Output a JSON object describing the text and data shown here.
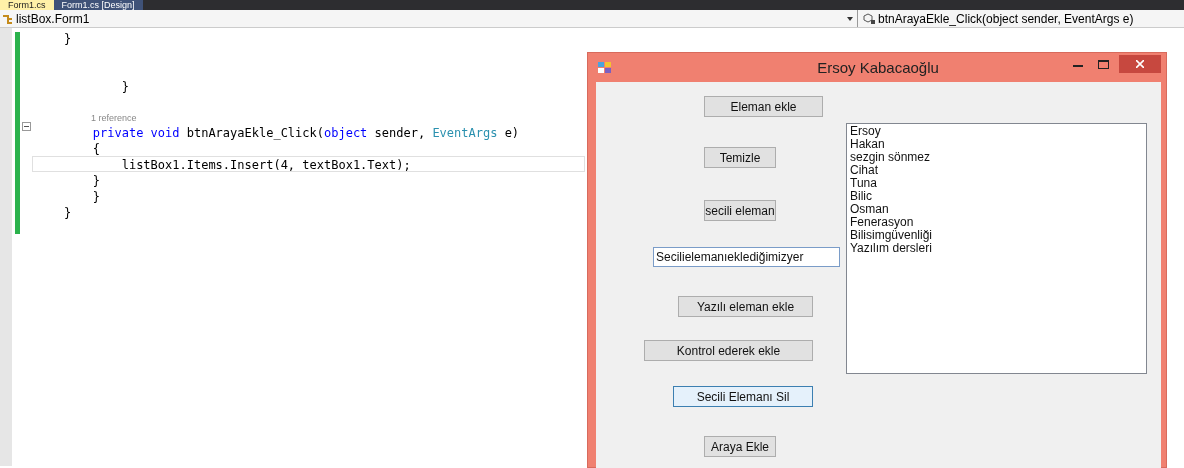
{
  "tabs": [
    {
      "label": "Form1.cs",
      "selected": true
    },
    {
      "label": "Form1.cs [Design]",
      "selected": false
    }
  ],
  "nav_bar": {
    "class_dropdown": "listBox.Form1",
    "member_dropdown": "btnArayaEkle_Click(object sender, EventArgs e)"
  },
  "code_lines": [
    {
      "kind": "code",
      "current": false,
      "tokens": [
        {
          "text": "    }",
          "kind": "plain"
        }
      ]
    },
    {
      "kind": "blank"
    },
    {
      "kind": "blank"
    },
    {
      "kind": "code",
      "current": false,
      "tokens": [
        {
          "text": "            }",
          "kind": "plain"
        }
      ]
    },
    {
      "kind": "blank"
    },
    {
      "kind": "codelens",
      "text": "1 reference"
    },
    {
      "kind": "code",
      "current": false,
      "tokens": [
        {
          "text": "        private",
          "kind": "keyword"
        },
        {
          "text": " void",
          "kind": "keyword"
        },
        {
          "text": " btnArayaEkle_Click(",
          "kind": "plain"
        },
        {
          "text": "object",
          "kind": "keyword"
        },
        {
          "text": " sender, ",
          "kind": "plain"
        },
        {
          "text": "EventArgs",
          "kind": "type"
        },
        {
          "text": " e)",
          "kind": "plain"
        }
      ]
    },
    {
      "kind": "code",
      "current": false,
      "tokens": [
        {
          "text": "        {",
          "kind": "plain"
        }
      ]
    },
    {
      "kind": "code",
      "current": true,
      "tokens": [
        {
          "text": "            listBox1.Items.Insert(4, textBox1.Text);",
          "kind": "plain"
        }
      ]
    },
    {
      "kind": "code",
      "current": false,
      "tokens": [
        {
          "text": "        }",
          "kind": "plain"
        }
      ]
    },
    {
      "kind": "code",
      "current": false,
      "tokens": [
        {
          "text": "        }",
          "kind": "plain"
        }
      ]
    },
    {
      "kind": "code",
      "current": false,
      "tokens": [
        {
          "text": "    }",
          "kind": "plain"
        }
      ]
    }
  ],
  "form": {
    "title": "Ersoy Kabacaoğlu",
    "controls": [
      {
        "kind": "button",
        "text": "Eleman ekle",
        "hover": false
      },
      {
        "kind": "button",
        "text": "Temizle",
        "hover": false
      },
      {
        "kind": "button",
        "text": "secili eleman",
        "hover": false
      },
      {
        "kind": "textbox",
        "value": "Secilielemanıeklediğimizyer"
      },
      {
        "kind": "button",
        "text": "Yazılı eleman ekle",
        "hover": false
      },
      {
        "kind": "button",
        "text": "Kontrol ederek ekle",
        "hover": false
      },
      {
        "kind": "button",
        "text": "Secili Elemanı Sil",
        "hover": true
      },
      {
        "kind": "button",
        "text": "Araya Ekle",
        "hover": false
      }
    ],
    "list_items": [
      "Ersoy",
      "Hakan",
      "sezgin sönmez",
      "Cihat",
      "Tuna",
      "Bilic",
      "Osman",
      "Fenerasyon",
      "Bilisimgüvenliği",
      "Yazılım dersleri"
    ]
  }
}
